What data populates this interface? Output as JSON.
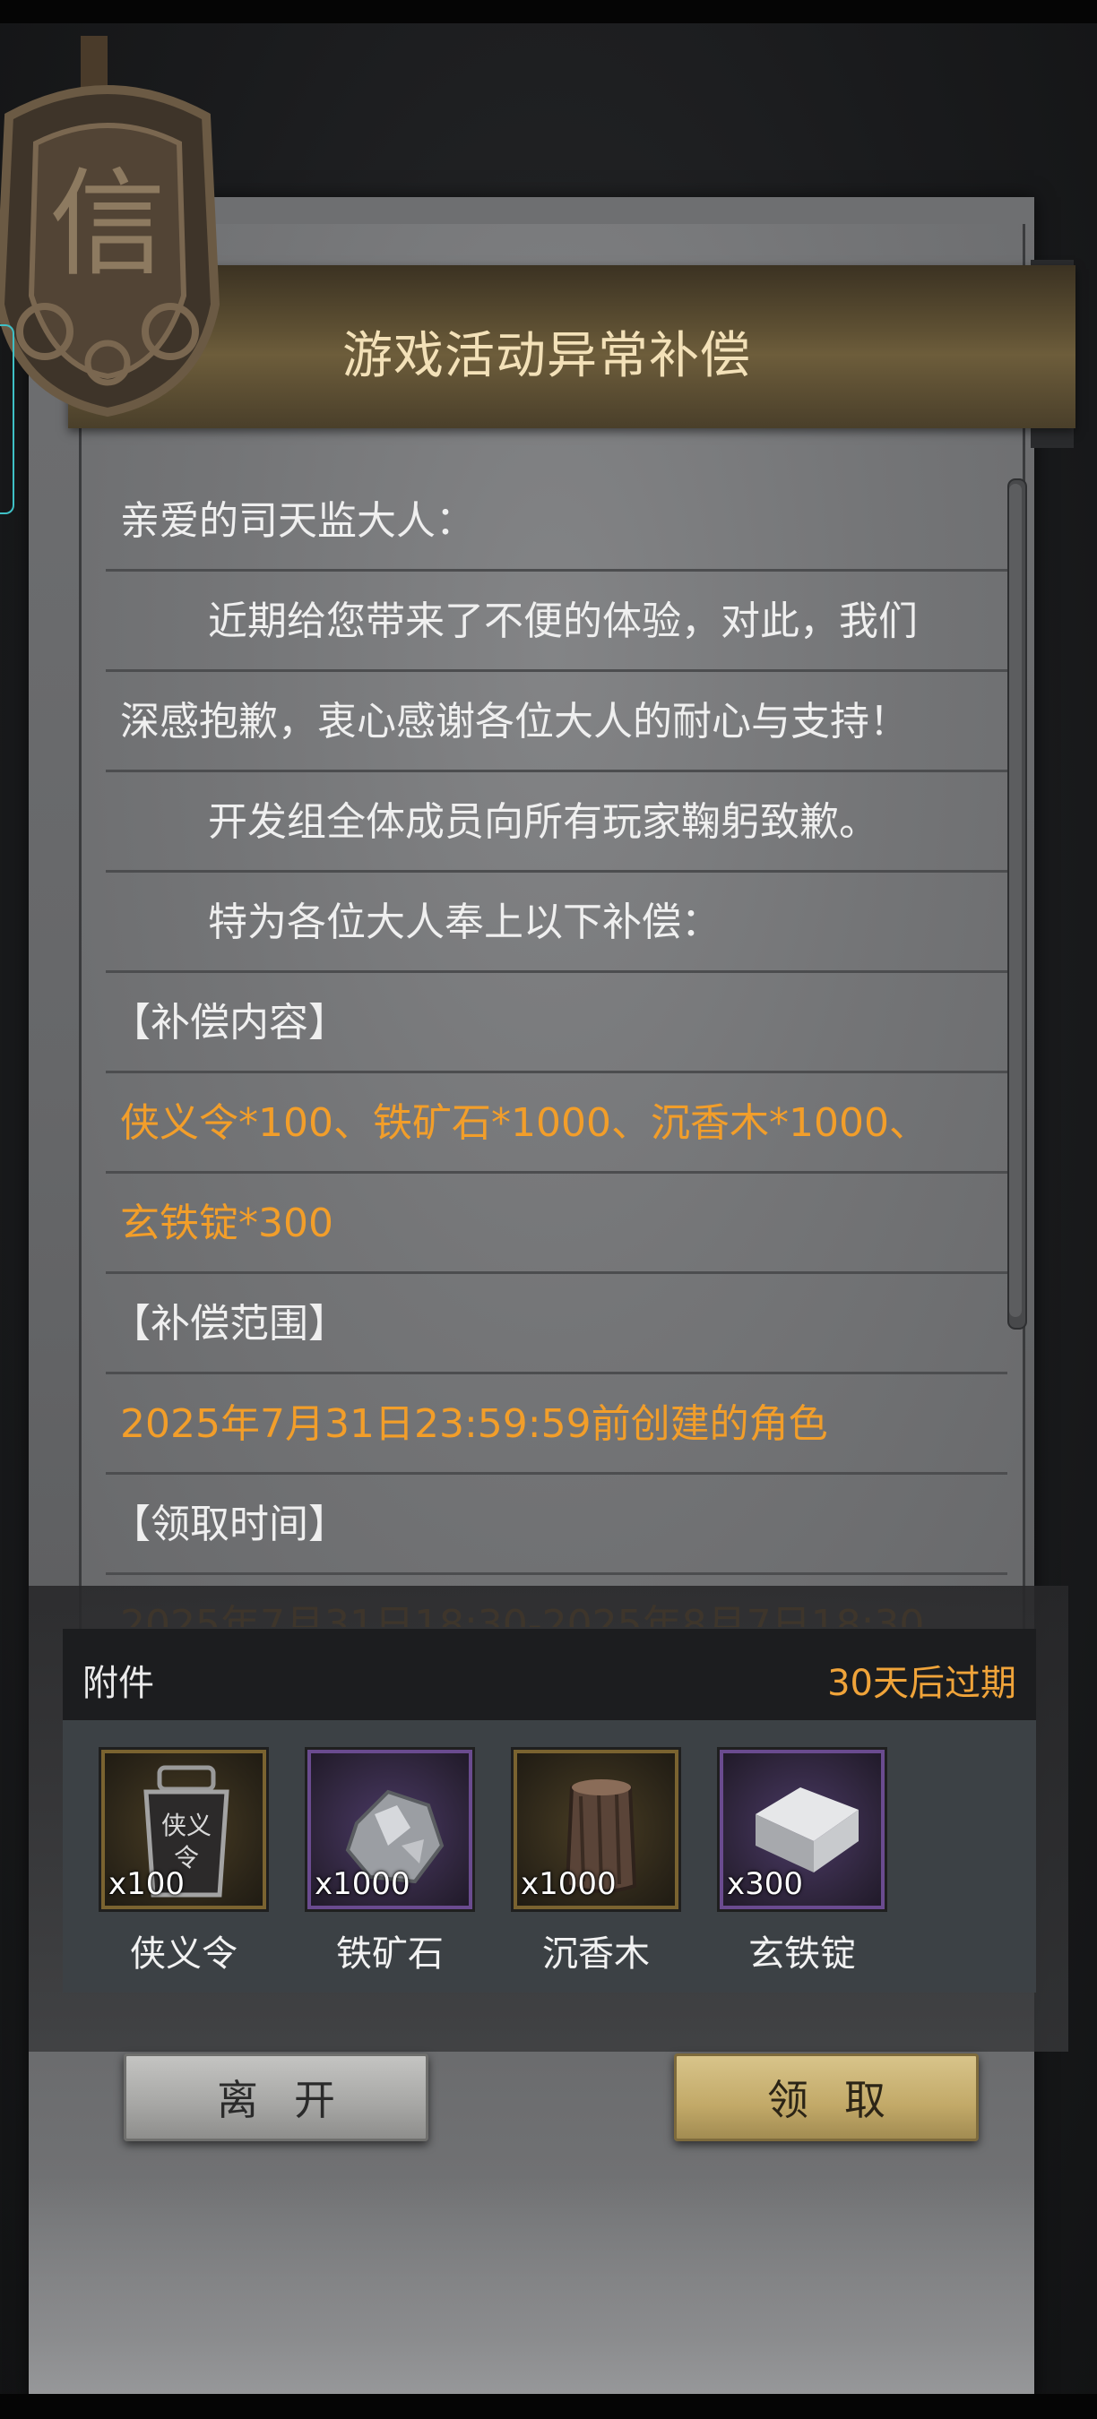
{
  "mail": {
    "title": "游戏活动异常补偿",
    "lines": [
      "亲爱的司天监大人：",
      "近期给您带来了不便的体验，对此，我们",
      "深感抱歉，衷心感谢各位大人的耐心与支持！",
      "开发组全体成员向所有玩家鞠躬致歉。",
      "特为各位大人奉上以下补偿：",
      "【补偿内容】",
      "侠义令*100、铁矿石*1000、沉香木*1000、",
      "玄铁锭*300",
      "【补偿范围】",
      "2025年7月31日23:59:59前创建的角色",
      "【领取时间】",
      "2025年7月31日18:30-2025年8月7日18:30"
    ]
  },
  "seal": {
    "glyph": "信"
  },
  "attachments": {
    "label": "附件",
    "expire": "30天后过期",
    "items": [
      {
        "name": "侠义令",
        "qty": "x100",
        "rarity": "gold",
        "icon": "token-icon"
      },
      {
        "name": "铁矿石",
        "qty": "x1000",
        "rarity": "purple",
        "icon": "iron-ore-icon"
      },
      {
        "name": "沉香木",
        "qty": "x1000",
        "rarity": "gold",
        "icon": "agarwood-icon"
      },
      {
        "name": "玄铁锭",
        "qty": "x300",
        "rarity": "purple",
        "icon": "iron-ingot-icon"
      }
    ]
  },
  "buttons": {
    "leave": "离开",
    "claim": "领取"
  },
  "colors": {
    "highlight": "#f29e2a",
    "expire": "#f0a43a",
    "title": "#f3e1b8"
  }
}
